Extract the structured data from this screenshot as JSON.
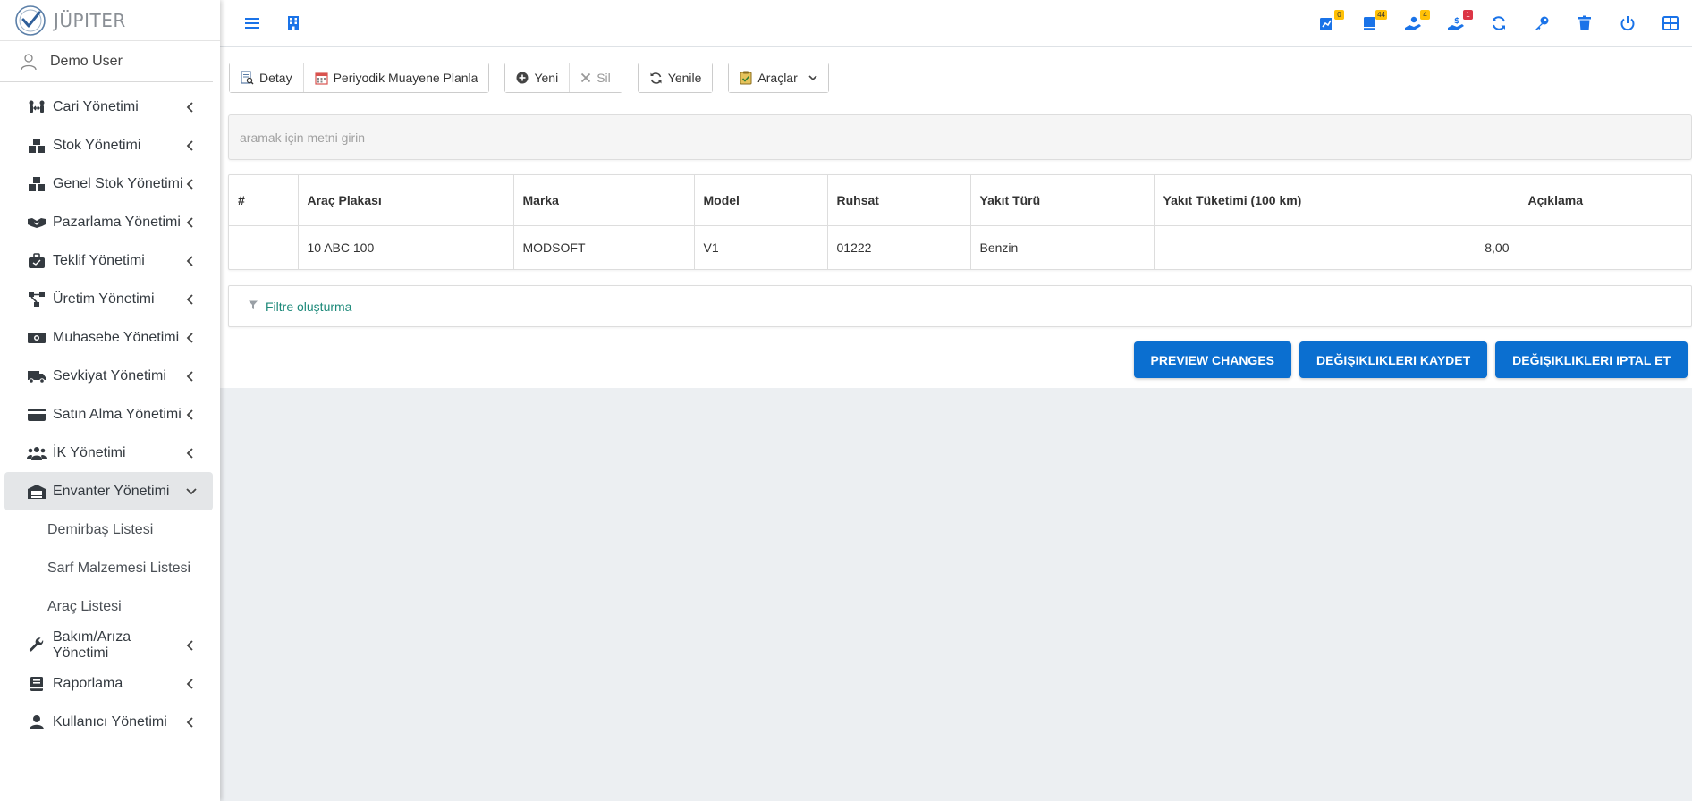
{
  "app": {
    "brand": "JÜPITER",
    "user": "Demo User"
  },
  "colors": {
    "primary": "#0b6fd0",
    "filter_link": "#1e8a7a",
    "badge_warn": "#ffc107",
    "badge_danger": "#dc3545",
    "icon_blue": "#1a73e8"
  },
  "sidebar": {
    "items": [
      {
        "label": "Cari Yönetimi",
        "icon": "people-arrows-icon"
      },
      {
        "label": "Stok Yönetimi",
        "icon": "boxes-icon"
      },
      {
        "label": "Genel Stok Yönetimi",
        "icon": "boxes-icon"
      },
      {
        "label": "Pazarlama Yönetimi",
        "icon": "handshake-icon"
      },
      {
        "label": "Teklif Yönetimi",
        "icon": "briefcase-icon"
      },
      {
        "label": "Üretim Yönetimi",
        "icon": "project-diagram-icon"
      },
      {
        "label": "Muhasebe Yönetimi",
        "icon": "money-bill-icon"
      },
      {
        "label": "Sevkiyat Yönetimi",
        "icon": "truck-icon"
      },
      {
        "label": "Satın Alma Yönetimi",
        "icon": "credit-card-icon"
      },
      {
        "label": "İK Yönetimi",
        "icon": "users-icon"
      },
      {
        "label": "Envanter Yönetimi",
        "icon": "warehouse-icon",
        "expanded": true
      },
      {
        "label": "Bakım/Arıza Yönetimi",
        "icon": "wrench-icon"
      },
      {
        "label": "Raporlama",
        "icon": "book-icon"
      },
      {
        "label": "Kullanıcı Yönetimi",
        "icon": "user-icon"
      }
    ],
    "subitems": [
      {
        "label": "Demirbaş Listesi"
      },
      {
        "label": "Sarf Malzemesi Listesi"
      },
      {
        "label": "Araç Listesi"
      }
    ]
  },
  "topbar": {
    "badges": {
      "chart": "0",
      "book": "44",
      "user_hand": "4",
      "dollar_hand": "1"
    }
  },
  "toolbar": {
    "detail": "Detay",
    "schedule": "Periyodik Muayene Planla",
    "new": "Yeni",
    "delete": "Sil",
    "refresh": "Yenile",
    "tools": "Araçlar"
  },
  "search": {
    "placeholder": "aramak için metni girin"
  },
  "grid": {
    "columns": [
      "#",
      "Araç Plakası",
      "Marka",
      "Model",
      "Ruhsat",
      "Yakıt Türü",
      "Yakıt Tüketimi (100 km)",
      "Açıklama"
    ],
    "rows": [
      [
        "",
        "10 ABC 100",
        "MODSOFT",
        "V1",
        "01222",
        "Benzin",
        "8,00",
        ""
      ]
    ]
  },
  "filter": {
    "label": "Filtre oluşturma"
  },
  "actions": {
    "preview": "PREVIEW CHANGES",
    "save": "DEĞIŞIKLIKLERI KAYDET",
    "cancel": "DEĞIŞIKLIKLERI IPTAL ET"
  }
}
